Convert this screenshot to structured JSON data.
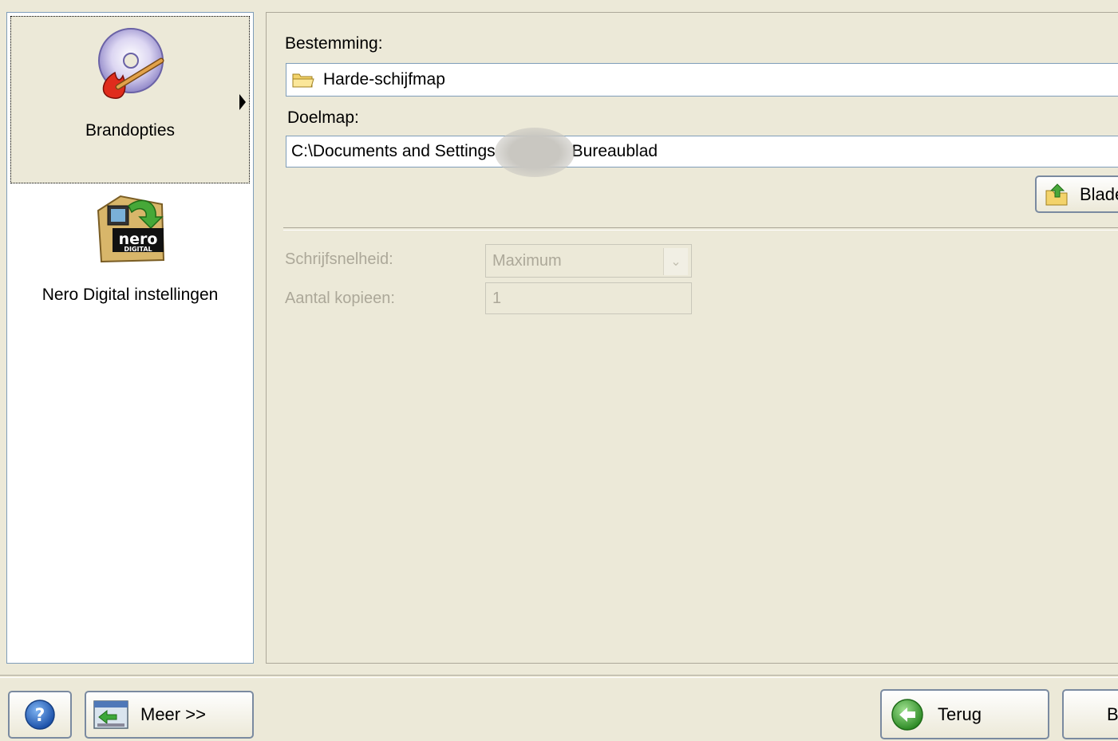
{
  "sidebar": {
    "items": [
      {
        "label": "Brandopties",
        "icon": "burn-disc-icon",
        "selected": true
      },
      {
        "label": "Nero Digital instellingen",
        "icon": "nero-digital-icon",
        "selected": false
      }
    ]
  },
  "destination": {
    "label": "Bestemming:",
    "value": "Harde-schijfmap"
  },
  "target_folder": {
    "label": "Doelmap:",
    "value_prefix": "C:\\Documents and Settings",
    "value_suffix": "Bureaublad"
  },
  "browse_button": {
    "label": "Blade"
  },
  "write_speed": {
    "label": "Schrijfsnelheid:",
    "value": "Maximum"
  },
  "copies": {
    "label": "Aantal kopieen:",
    "value": "1"
  },
  "footer": {
    "more_label": "Meer >>",
    "back_label": "Terug",
    "next_label": "B"
  }
}
